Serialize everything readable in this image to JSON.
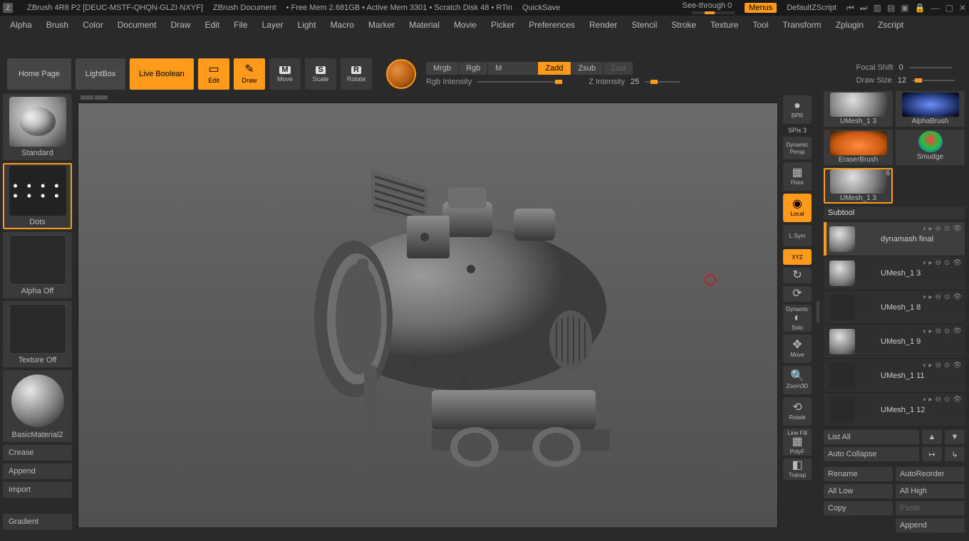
{
  "titlebar": {
    "app": "ZBrush 4R8 P2 [DEUC-MSTF-QHQN-GLZI-NXYF]",
    "doc": "ZBrush Document",
    "status": "• Free Mem 2.681GB • Active Mem 3301 • Scratch Disk 48 •  RTin",
    "quicksave": "QuickSave",
    "see_through": "See-through  0",
    "menus": "Menus",
    "default_script": "DefaultZScript"
  },
  "menubar": [
    "Alpha",
    "Brush",
    "Color",
    "Document",
    "Draw",
    "Edit",
    "File",
    "Layer",
    "Light",
    "Macro",
    "Marker",
    "Material",
    "Movie",
    "Picker",
    "Preferences",
    "Render",
    "Stencil",
    "Stroke",
    "Texture",
    "Tool",
    "Transform",
    "Zplugin",
    "Zscript"
  ],
  "toolbar": {
    "home": "Home Page",
    "lightbox": "LightBox",
    "live_boolean": "Live Boolean",
    "edit": "Edit",
    "draw": "Draw",
    "move": "Move",
    "scale": "Scale",
    "rotate": "Rotate",
    "modes": [
      "Mrgb",
      "Rgb",
      "M",
      "Zadd",
      "Zsub",
      "Zcut"
    ],
    "rgb_intensity_label": "Rgb Intensity",
    "z_intensity_label": "Z Intensity",
    "z_intensity_val": "25",
    "focal_shift_label": "Focal Shift",
    "focal_shift_val": "0",
    "draw_size_label": "Draw Size",
    "draw_size_val": "12"
  },
  "left": {
    "brush": "Standard",
    "stroke": "Dots",
    "alpha": "Alpha Off",
    "texture": "Texture Off",
    "material": "BasicMaterial2",
    "crease": "Crease",
    "append": "Append",
    "import": "Import",
    "gradient": "Gradient"
  },
  "side_strip": {
    "bpr": "BPR",
    "spix_lbl": "SPix",
    "spix_val": "3",
    "dynamic": "Dynamic",
    "persp": "Persp",
    "floor": "Floor",
    "local": "Local",
    "lsym": "L.Sym",
    "xyz": "XYZ",
    "solo_dynamic": "Dynamic",
    "solo": "Solo",
    "move": "Move",
    "zoom3d": "Zoom3D",
    "rotate": "Rotate",
    "linefill": "Line Fill",
    "polyf": "PolyF",
    "transp": "Transp"
  },
  "tool_grid": {
    "umesh13a": "UMesh_1 3",
    "alphabrush": "AlphaBrush",
    "eraser": "EraserBrush",
    "smudge": "Smudge",
    "umesh13b": "UMesh_1 3",
    "badge6": "6"
  },
  "subtool": {
    "header": "Subtool",
    "items": [
      {
        "name": "dynamash final",
        "sel": true
      },
      {
        "name": "UMesh_1 3",
        "sel": false
      },
      {
        "name": "UMesh_1 8",
        "sel": false
      },
      {
        "name": "UMesh_1 9",
        "sel": false
      },
      {
        "name": "UMesh_1 11",
        "sel": false
      },
      {
        "name": "UMesh_1 12",
        "sel": false
      }
    ],
    "list_all": "List All",
    "auto_collapse": "Auto Collapse",
    "rename": "Rename",
    "auto_reorder": "AutoReorder",
    "all_low": "All Low",
    "all_high": "All High",
    "copy": "Copy",
    "paste": "Paste",
    "append2": "Append"
  }
}
